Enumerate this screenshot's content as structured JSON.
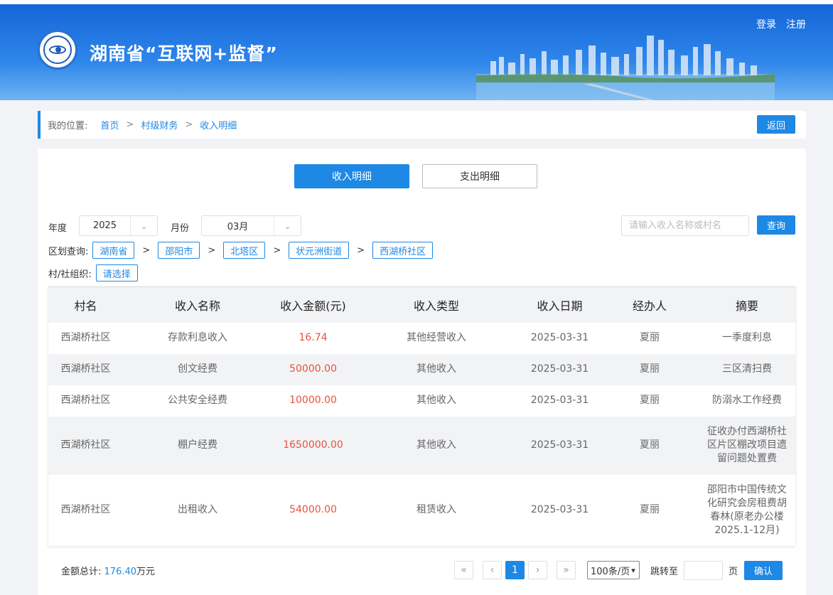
{
  "header": {
    "title": "湖南省“互联网+监督”",
    "login": "登录",
    "register": "注册"
  },
  "breadcrumb": {
    "label": "我的位置:",
    "items": [
      "首页",
      "村级财务",
      "收入明细"
    ],
    "separator": ">",
    "back": "返回"
  },
  "tabs": {
    "income": "收入明细",
    "expense": "支出明细"
  },
  "filters": {
    "year_label": "年度",
    "year_value": "2025",
    "month_label": "月份",
    "month_value": "03月",
    "search_placeholder": "请输入收入名称或村名",
    "query": "查询",
    "region_label": "区划查询:",
    "region_path": [
      "湖南省",
      "邵阳市",
      "北塔区",
      "状元洲街道",
      "西湖桥社区"
    ],
    "org_label": "村/社组织:",
    "org_value": "请选择"
  },
  "table": {
    "headers": [
      "村名",
      "收入名称",
      "收入金额(元)",
      "收入类型",
      "收入日期",
      "经办人",
      "摘要"
    ],
    "rows": [
      [
        "西湖桥社区",
        "存款利息收入",
        "16.74",
        "其他经营收入",
        "2025-03-31",
        "夏丽",
        "一季度利息"
      ],
      [
        "西湖桥社区",
        "创文经费",
        "50000.00",
        "其他收入",
        "2025-03-31",
        "夏丽",
        "三区清扫费"
      ],
      [
        "西湖桥社区",
        "公共安全经费",
        "10000.00",
        "其他收入",
        "2025-03-31",
        "夏丽",
        "防溺水工作经费"
      ],
      [
        "西湖桥社区",
        "棚户经费",
        "1650000.00",
        "其他收入",
        "2025-03-31",
        "夏丽",
        "征收办付西湖桥社区片区棚改项目遗留问题处置费"
      ],
      [
        "西湖桥社区",
        "出租收入",
        "54000.00",
        "租赁收入",
        "2025-03-31",
        "夏丽",
        "邵阳市中国传统文化研究会房租费胡春林(原老办公楼2025.1-12月)"
      ]
    ]
  },
  "footer": {
    "total_label": "金额总计:",
    "total_value": "176.40",
    "total_unit": "万元",
    "first": "«",
    "prev": "‹",
    "current_page": "1",
    "next": "›",
    "last": "»",
    "page_size": "100条/页",
    "jump_label": "跳转至",
    "page_label": "页",
    "confirm": "确认"
  },
  "colors": {
    "accent": "#1e88e5",
    "amount": "#e5533d",
    "header_bg": "#1565d8"
  }
}
